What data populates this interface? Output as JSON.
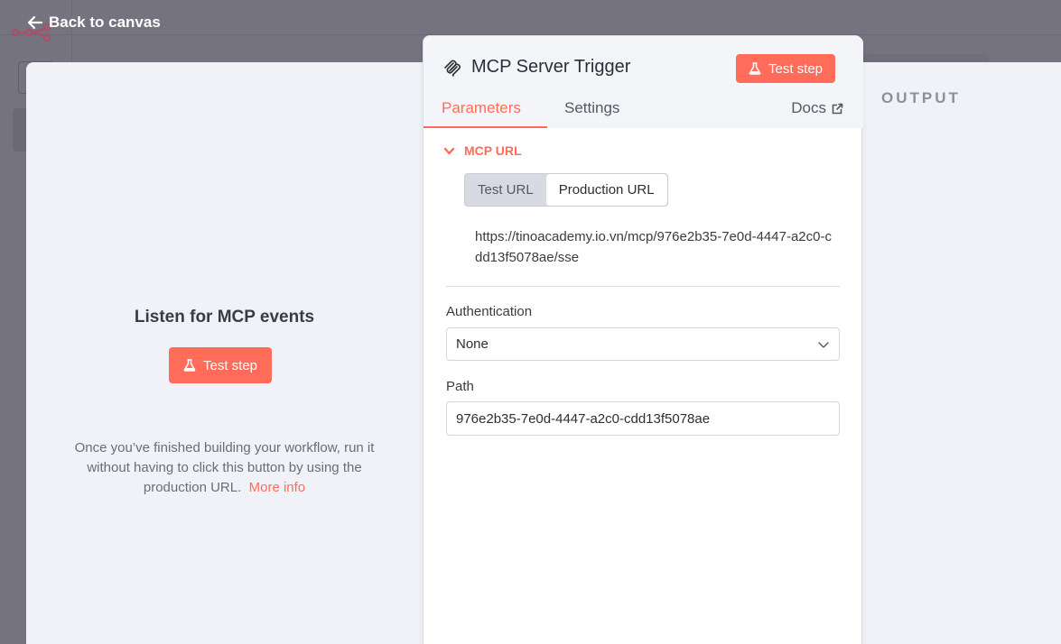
{
  "nav": {
    "back_label": "Back to canvas"
  },
  "input_pane": {
    "title": "Listen for MCP events",
    "test_button": "Test step",
    "hint": "Once you’ve finished building your workflow, run it without having to click this button by using the production URL.",
    "more_info": "More info"
  },
  "node": {
    "title": "MCP Server Trigger",
    "test_button": "Test step",
    "tabs": [
      {
        "label": "Parameters",
        "active": true
      },
      {
        "label": "Settings",
        "active": false
      }
    ],
    "docs_label": "Docs",
    "mcp_url": {
      "section_label": "MCP URL",
      "options": [
        "Test URL",
        "Production URL"
      ],
      "selected": "Production URL",
      "url": "https://tinoacademy.io.vn/mcp/976e2b35-7e0d-4447-a2c0-cdd13f5078ae/sse"
    },
    "authentication": {
      "label": "Authentication",
      "value": "None"
    },
    "path": {
      "label": "Path",
      "value": "976e2b35-7e0d-4447-a2c0-cdd13f5078ae"
    }
  },
  "output_pane": {
    "label": "OUTPUT"
  },
  "colors": {
    "accent": "#ff6d5a",
    "panel_bg": "#f1f2f7",
    "overlay": "#74737f"
  }
}
